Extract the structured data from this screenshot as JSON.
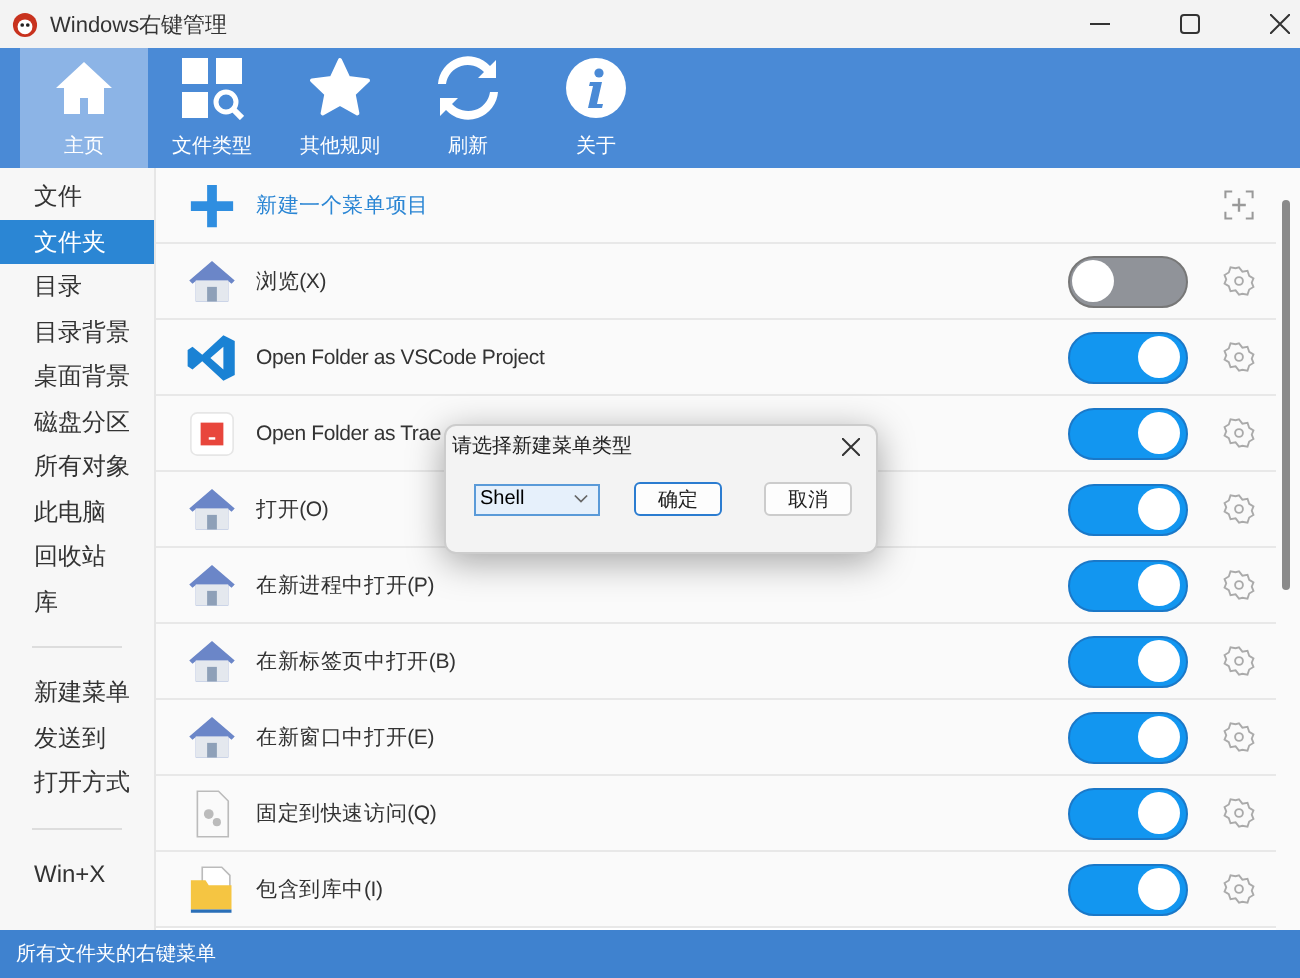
{
  "window": {
    "title": "Windows右键管理"
  },
  "toolbar": [
    {
      "label": "主页",
      "kind": "home",
      "selected": true
    },
    {
      "label": "文件类型",
      "kind": "types",
      "selected": false
    },
    {
      "label": "其他规则",
      "kind": "star",
      "selected": false
    },
    {
      "label": "刷新",
      "kind": "refresh",
      "selected": false
    },
    {
      "label": "关于",
      "kind": "info",
      "selected": false
    }
  ],
  "sidebar": {
    "groups": [
      [
        {
          "label": "文件",
          "selected": false
        },
        {
          "label": "文件夹",
          "selected": true
        },
        {
          "label": "目录",
          "selected": false
        },
        {
          "label": "目录背景",
          "selected": false
        },
        {
          "label": "桌面背景",
          "selected": false
        },
        {
          "label": "磁盘分区",
          "selected": false
        },
        {
          "label": "所有对象",
          "selected": false
        },
        {
          "label": "此电脑",
          "selected": false
        },
        {
          "label": "回收站",
          "selected": false
        },
        {
          "label": "库",
          "selected": false
        }
      ],
      [
        {
          "label": "新建菜单",
          "selected": false
        },
        {
          "label": "发送到",
          "selected": false
        },
        {
          "label": "打开方式",
          "selected": false
        }
      ],
      [
        {
          "label": "Win+X",
          "selected": false
        }
      ]
    ]
  },
  "new_item": {
    "label": "新建一个菜单项目"
  },
  "items": [
    {
      "label": "浏览(X)",
      "kind": "house",
      "on": false
    },
    {
      "label": "Open Folder as VSCode Project",
      "kind": "vscode",
      "on": true
    },
    {
      "label": "Open Folder as Trae",
      "kind": "trae",
      "on": true
    },
    {
      "label": "打开(O)",
      "kind": "house",
      "on": true
    },
    {
      "label": "在新进程中打开(P)",
      "kind": "house",
      "on": true
    },
    {
      "label": "在新标签页中打开(B)",
      "kind": "house",
      "on": true
    },
    {
      "label": "在新窗口中打开(E)",
      "kind": "house",
      "on": true
    },
    {
      "label": "固定到快速访问(Q)",
      "kind": "docgear",
      "on": true
    },
    {
      "label": "包含到库中(I)",
      "kind": "folder",
      "on": true
    }
  ],
  "dialog": {
    "title": "请选择新建菜单类型",
    "combo_value": "Shell",
    "buttons": [
      {
        "label": "确定",
        "selected": true
      },
      {
        "label": "取消",
        "selected": false
      }
    ]
  },
  "status_bar": "所有文件夹的右键菜单"
}
